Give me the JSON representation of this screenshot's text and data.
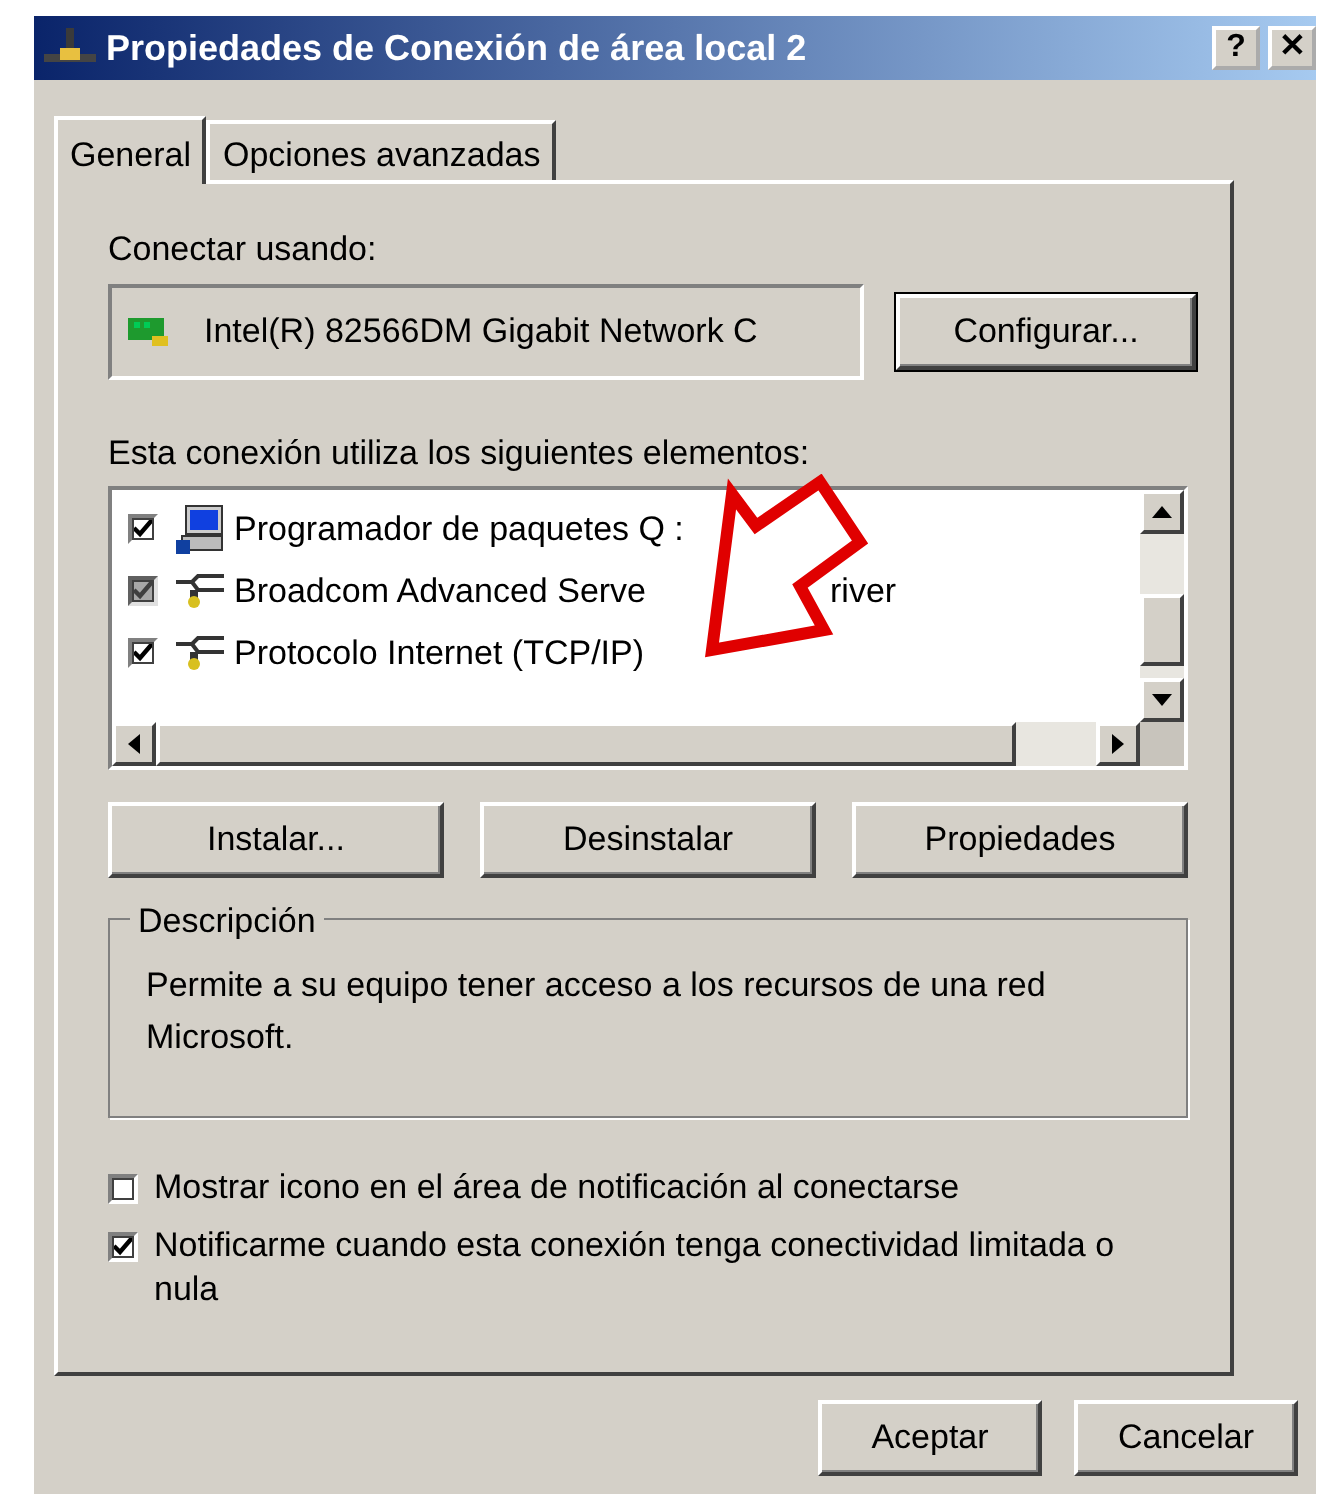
{
  "window": {
    "title": "Propiedades de Conexión de área local 2",
    "buttons": [
      "?",
      "✕"
    ]
  },
  "tabs": [
    {
      "label": "General",
      "selected": true
    },
    {
      "label": "Opciones avanzadas",
      "selected": false
    }
  ],
  "connect_using": {
    "label": "Conectar usando:",
    "adapter": "Intel(R) 82566DM Gigabit Network C",
    "button": "Configurar..."
  },
  "components": {
    "label": "Esta conexión utiliza los siguientes elementos:",
    "items": [
      {
        "kind": "scheduler",
        "label": "Programador de paquetes Q :",
        "checked": true,
        "disabled": false
      },
      {
        "kind": "protocol",
        "label": "Broadcom Advanced Serve",
        "label_tail": "river",
        "checked": true,
        "disabled": true
      },
      {
        "kind": "protocol",
        "label": "Protocolo Internet (TCP/IP)",
        "checked": true,
        "disabled": false
      }
    ],
    "buttons": [
      "Instalar...",
      "Desinstalar",
      "Propiedades"
    ]
  },
  "description": {
    "title": "Descripción",
    "text": "Permite a su equipo tener acceso a los recursos de una red Microsoft."
  },
  "options": [
    {
      "label": "Mostrar icono en el área de notificación al conectarse",
      "checked": false
    },
    {
      "label": "Notificarme cuando esta conexión tenga conectividad limitada o nula",
      "checked": true
    }
  ],
  "footer_buttons": [
    "Aceptar",
    "Cancelar"
  ]
}
